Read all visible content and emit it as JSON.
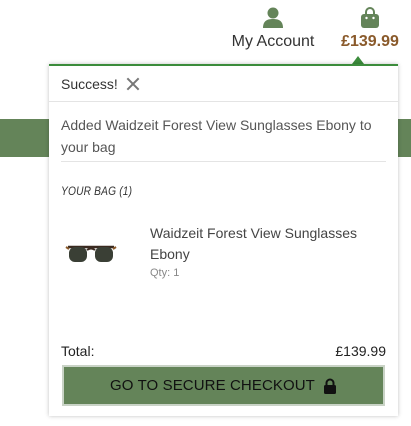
{
  "header": {
    "account_label": "My Account",
    "bag_total": "£139.99",
    "account_icon": "user-icon",
    "bag_icon": "shopping-bag-icon"
  },
  "dropdown": {
    "status": "Success!",
    "message": "Added Waidzeit Forest View Sunglasses Ebony to your bag",
    "bag_title": "YOUR BAG (1)",
    "items": [
      {
        "name": "Waidzeit Forest View Sunglasses Ebony",
        "qty": "Qty: 1",
        "icon": "sunglasses-image"
      }
    ],
    "total_label": "Total:",
    "total_value": "£139.99",
    "checkout_label": "GO TO SECURE CHECKOUT",
    "checkout_icon": "lock-icon"
  },
  "colors": {
    "accent_green": "#648459",
    "border_green": "#3c8c3c",
    "price_brown": "#8a5a2b"
  }
}
